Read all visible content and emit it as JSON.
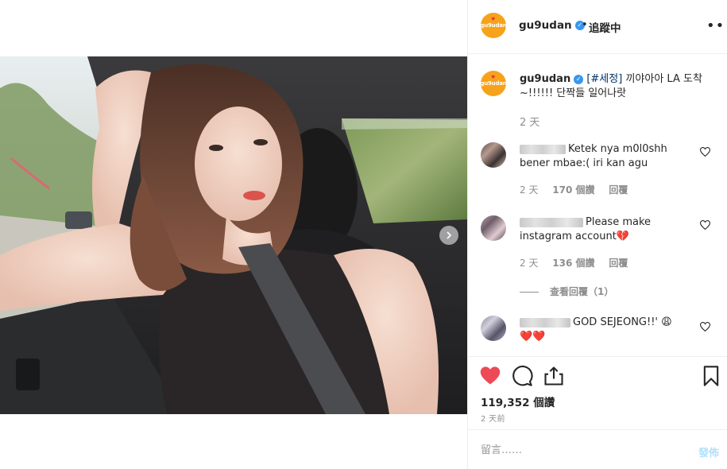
{
  "post": {
    "username": "gu9udan",
    "avatar_text": "gu9udan",
    "verified_glyph": "✓",
    "dot": "•",
    "follow_status": "追蹤中",
    "more_glyph": "•••"
  },
  "caption": {
    "username": "gu9udan",
    "hashtag": "[#세정]",
    "text": "끼야아아 LA 도착~!!!!!! 단짝들 일어나랏",
    "time": "2 天"
  },
  "comments": [
    {
      "text": "Ketek nya m0l0shh bener mbae:( iri kan agu",
      "time": "2 天",
      "likes": "170 個讚",
      "reply": "回覆"
    },
    {
      "text": "Please make instagram account💔",
      "time": "2 天",
      "likes": "136 個讚",
      "reply": "回覆",
      "view_replies": "查看回覆（1）"
    },
    {
      "text_prefix": "GOD SEJEONG!!' 😩",
      "text_line2": "❤️❤️"
    }
  ],
  "actions": {
    "likes_count": "119,352 個讚",
    "time_ago": "2 天前"
  },
  "comment_box": {
    "placeholder": "留言……",
    "post_label": "發佈"
  },
  "colors": {
    "brand_orange": "#f7a21b",
    "heart_red": "#ed4956",
    "link_blue": "#003569",
    "verified_blue": "#3897f0"
  }
}
